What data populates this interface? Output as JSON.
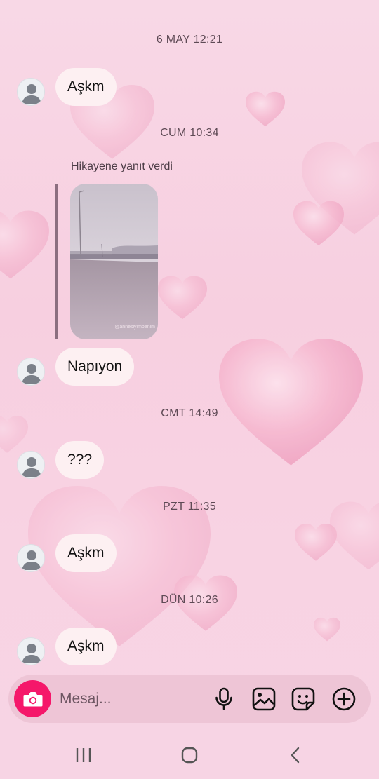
{
  "conversation": {
    "groups": [
      {
        "timestamp": "6 MAY 12:21",
        "message": "Aşkm"
      },
      {
        "timestamp": "CUM 10:34",
        "reply_label": "Hikayene yanıt verdi",
        "story_watermark": "@annesiyimbenim",
        "message": "Napıyon"
      },
      {
        "timestamp": "CMT 14:49",
        "message": "???"
      },
      {
        "timestamp": "PZT 11:35",
        "message": "Aşkm"
      },
      {
        "timestamp": "DÜN 10:26",
        "message": "Aşkm"
      }
    ]
  },
  "composer": {
    "placeholder": "Mesaj...",
    "icons": [
      "camera-icon",
      "microphone-icon",
      "gallery-icon",
      "sticker-icon",
      "add-icon"
    ]
  },
  "navbar": {
    "icons": [
      "recent-apps-icon",
      "home-icon",
      "back-icon"
    ]
  },
  "colors": {
    "background": "#f8d3e3",
    "bubble": "#fdf0f2",
    "camera_button": "#f5176a",
    "composer": "#eec5d6"
  }
}
